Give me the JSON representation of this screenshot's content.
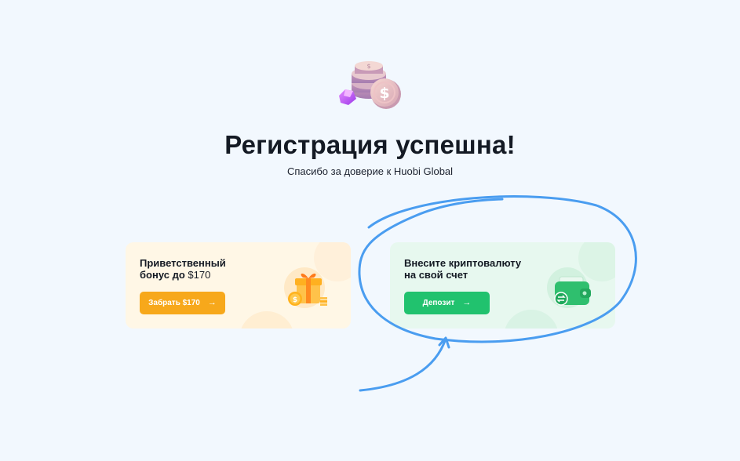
{
  "header": {
    "title": "Регистрация успешна!",
    "subtitle": "Спасибо за доверие к Huobi Global"
  },
  "hero": {
    "icon": "coins-and-gem-icon"
  },
  "cards": {
    "bonus": {
      "title": "Приветственный бонус до",
      "amount": "$170",
      "button_label": "Забрать $170",
      "icon": "gift-box-icon",
      "accent": "#f7a81b"
    },
    "deposit": {
      "title": "Внесите криптовалюту на свой счет",
      "button_label": "Депозит",
      "icon": "wallet-icon",
      "accent": "#21c26e"
    }
  },
  "annotation": {
    "type": "hand-drawn circle with arrow",
    "color": "#4a9df0"
  },
  "colors": {
    "background": "#f2f8fe",
    "bonus_card_bg": "#fff7e6",
    "deposit_card_bg": "#e7f8ef"
  }
}
